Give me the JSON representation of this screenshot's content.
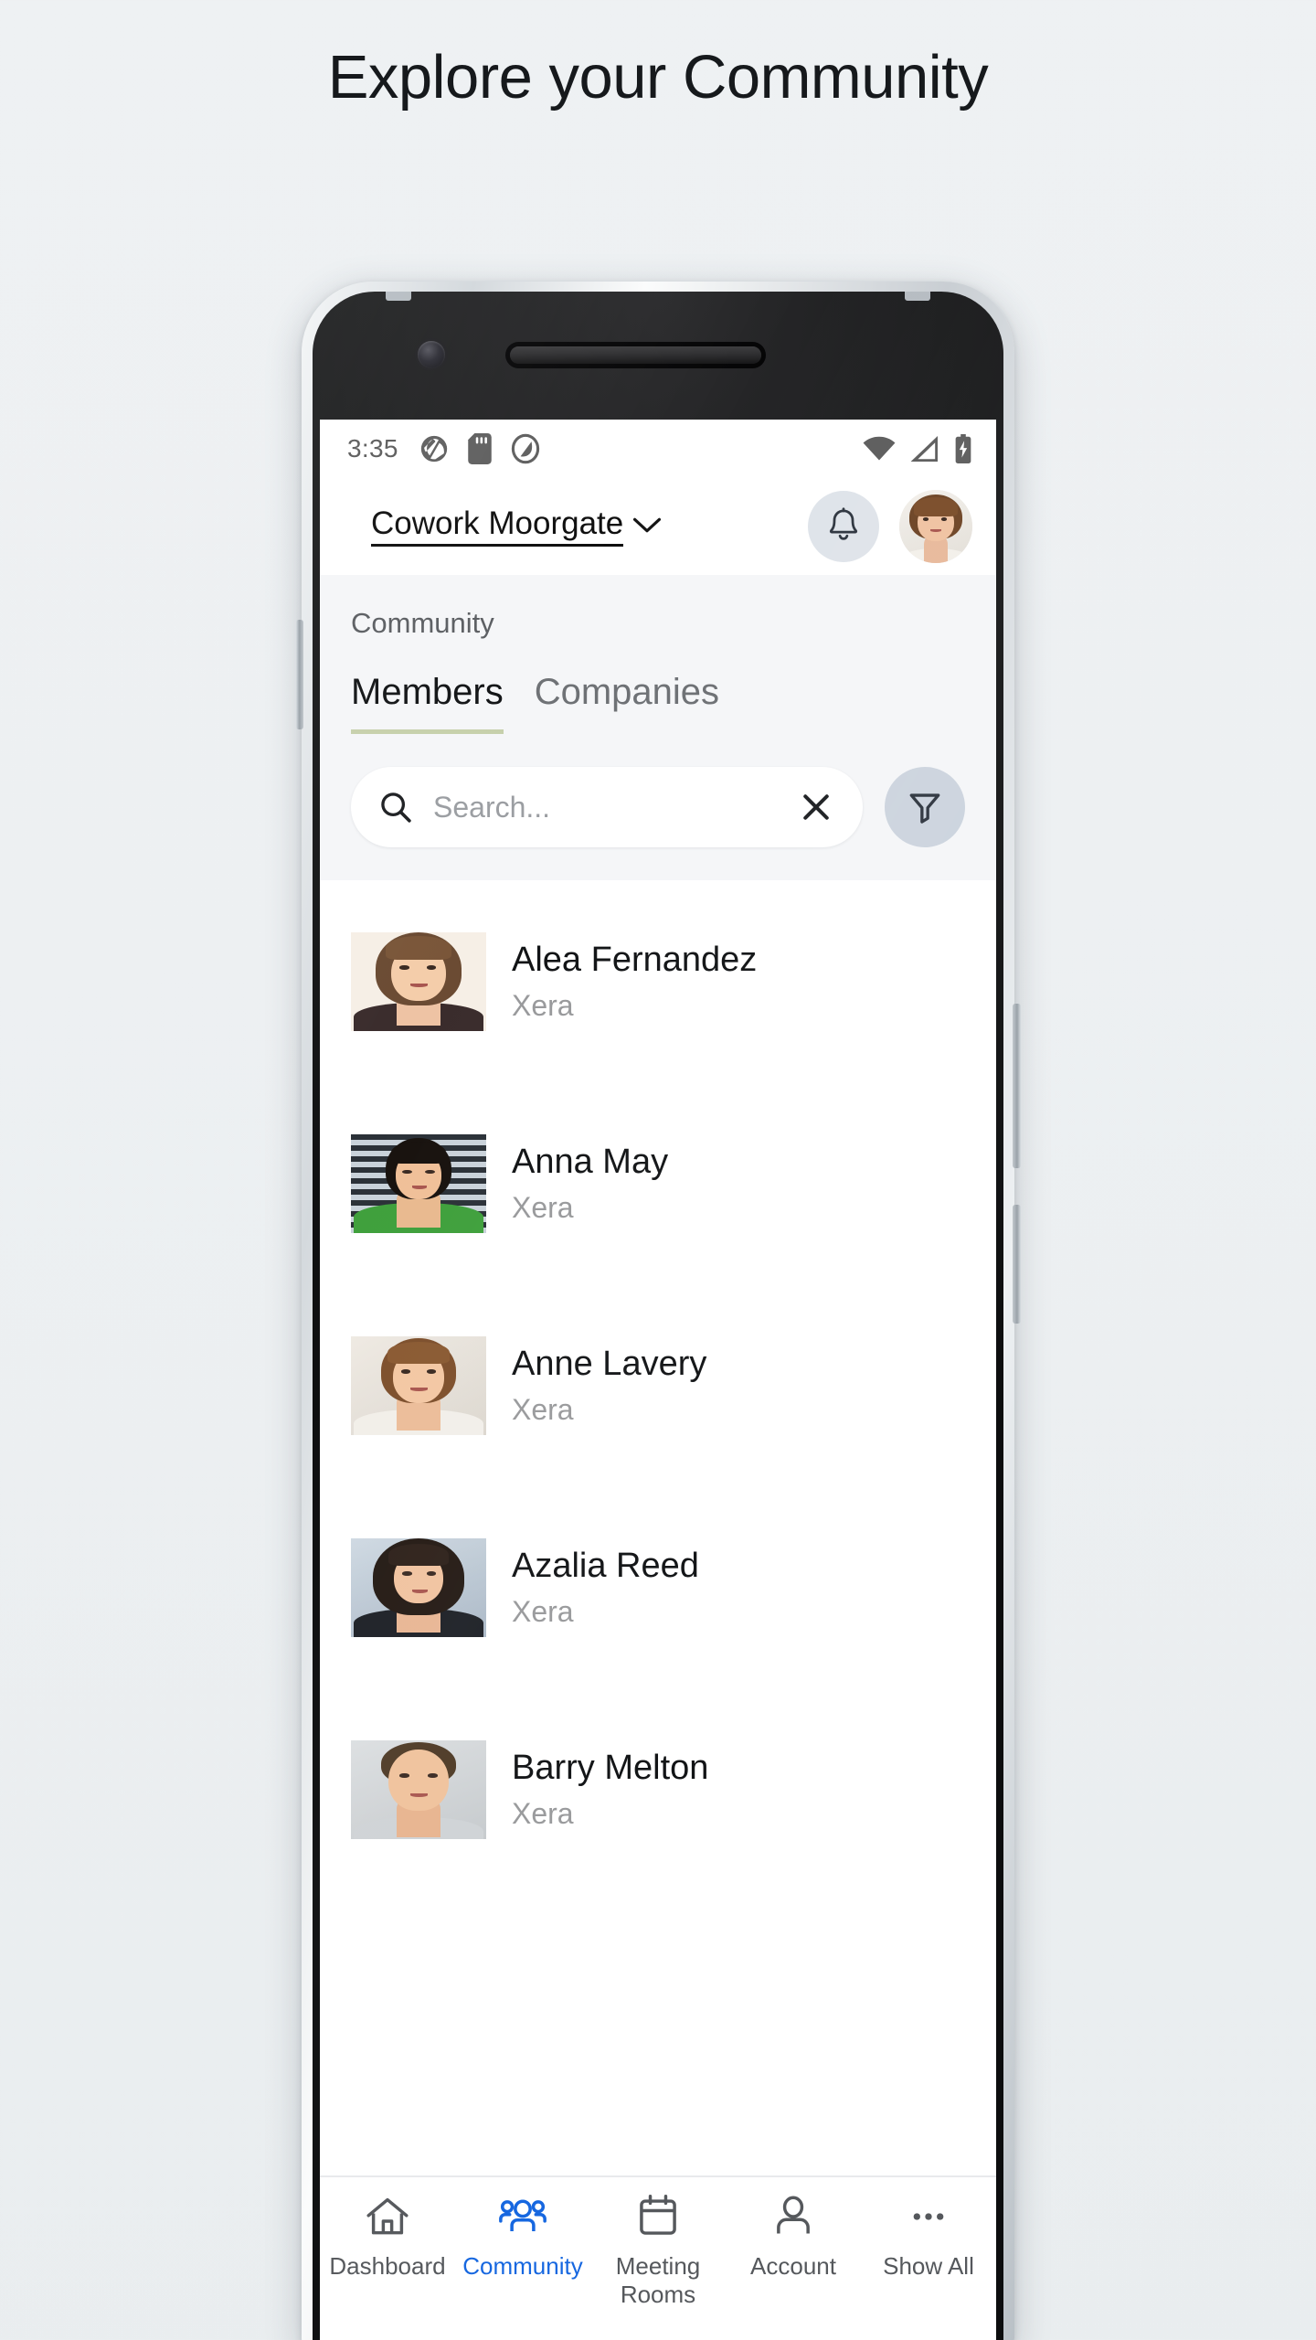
{
  "page": {
    "headline": "Explore your Community"
  },
  "status_bar": {
    "time": "3:35",
    "left_icons": [
      "camera-shutter-icon",
      "sd-card-icon",
      "adobe-icon"
    ],
    "right_icons": [
      "wifi-icon",
      "cell-signal-icon",
      "battery-charging-icon"
    ]
  },
  "app_bar": {
    "venue_name": "Cowork Moorgate",
    "venue_chevron": "chevron-down-icon",
    "bell_icon": "bell-icon",
    "avatar": "user-avatar"
  },
  "section": {
    "title": "Community",
    "tabs": [
      {
        "label": "Members",
        "active": true
      },
      {
        "label": "Companies",
        "active": false
      }
    ],
    "active_tab_underline_color": "#c6d0ab"
  },
  "search": {
    "placeholder": "Search...",
    "value": "",
    "search_icon": "search-icon",
    "clear_icon": "close-icon",
    "filter_icon": "filter-funnel-icon"
  },
  "members": [
    {
      "name": "Alea Fernandez",
      "company": "Xera"
    },
    {
      "name": "Anna May",
      "company": "Xera"
    },
    {
      "name": "Anne Lavery",
      "company": "Xera"
    },
    {
      "name": "Azalia Reed",
      "company": "Xera"
    },
    {
      "name": "Barry Melton",
      "company": "Xera"
    }
  ],
  "bottom_nav": {
    "active_color": "#1667e0",
    "inactive_color": "#55585c",
    "items": [
      {
        "label": "Dashboard",
        "icon": "home-icon",
        "active": false
      },
      {
        "label": "Community",
        "icon": "people-icon",
        "active": true
      },
      {
        "label": "Meeting Rooms",
        "icon": "calendar-icon",
        "active": false
      },
      {
        "label": "Account",
        "icon": "person-icon",
        "active": false
      },
      {
        "label": "Show All",
        "icon": "ellipsis-icon",
        "active": false
      }
    ]
  }
}
